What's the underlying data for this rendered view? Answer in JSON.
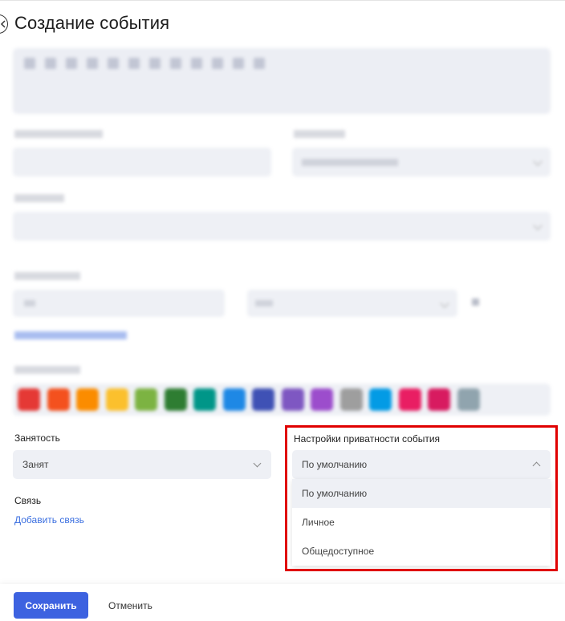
{
  "header": {
    "title": "Создание события"
  },
  "busy": {
    "label": "Занятость",
    "value": "Занят"
  },
  "connection": {
    "label": "Связь",
    "add_link": "Добавить связь"
  },
  "privacy": {
    "label": "Настройки приватности события",
    "value": "По умолчанию",
    "options": [
      "По умолчанию",
      "Личное",
      "Общедоступное"
    ]
  },
  "footer": {
    "save_label": "Сохранить",
    "cancel_label": "Отменить"
  },
  "colors": [
    "#e53935",
    "#f4511e",
    "#fb8c00",
    "#fbc02d",
    "#7cb342",
    "#2e7d32",
    "#009688",
    "#1e88e5",
    "#3f51b5",
    "#7e57c2",
    "#9c4dcc",
    "#9e9e9e",
    "#039be5",
    "#e91e63",
    "#d81b60",
    "#90a4ae"
  ],
  "highlight_color": "#e00000",
  "accent": "#3d62e0"
}
